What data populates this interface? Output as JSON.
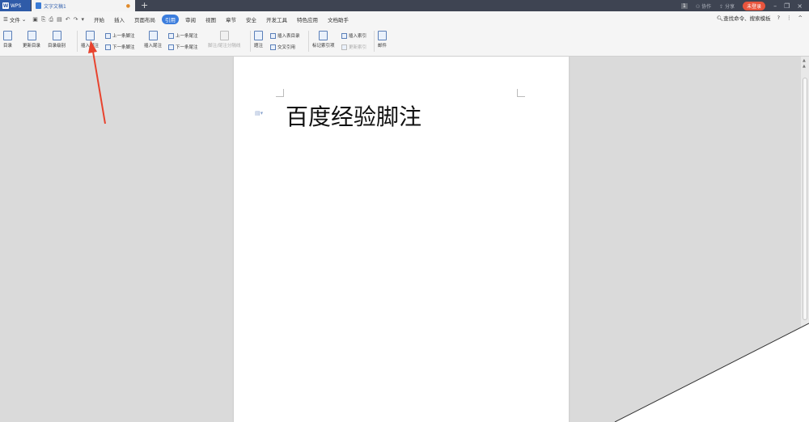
{
  "titlebar": {
    "app_label": "WPS",
    "doc_tab": "文字文稿1",
    "new_tab": "+",
    "right": {
      "badge": "1",
      "collab": "协作",
      "share": "分享",
      "login": "未登录",
      "min": "–",
      "restore": "❐",
      "close": "×"
    }
  },
  "menubar": {
    "file": "文件",
    "tabs": [
      "开始",
      "插入",
      "页面布局",
      "引用",
      "审阅",
      "视图",
      "章节",
      "安全",
      "开发工具",
      "特色应用",
      "文档助手"
    ],
    "active_tab": "引用",
    "search": "查找命令、搜索模板",
    "help": "?",
    "more": "⋮",
    "collapse": "^"
  },
  "ribbon": {
    "toc": "目录",
    "update_toc": "更新目录",
    "toc_level": "目录级别",
    "insert_footnote": "插入脚注",
    "prev_footnote": "上一条脚注",
    "next_footnote": "下一条脚注",
    "insert_endnote": "插入尾注",
    "prev_endnote": "上一条尾注",
    "next_endnote": "下一条尾注",
    "footnote_separator": "脚注/尾注分隔线",
    "caption": "题注",
    "insert_table_of_figures": "插入表目录",
    "cross_reference": "交叉引用",
    "mark_index_entry": "标记索引项",
    "insert_index": "插入索引",
    "update_index": "更新索引",
    "mail": "邮件"
  },
  "document": {
    "title": "百度经验脚注"
  },
  "colors": {
    "accent": "#3b7ddd",
    "titlebar": "#3e4452",
    "arrow": "#e8432e",
    "login": "#e8553d"
  }
}
